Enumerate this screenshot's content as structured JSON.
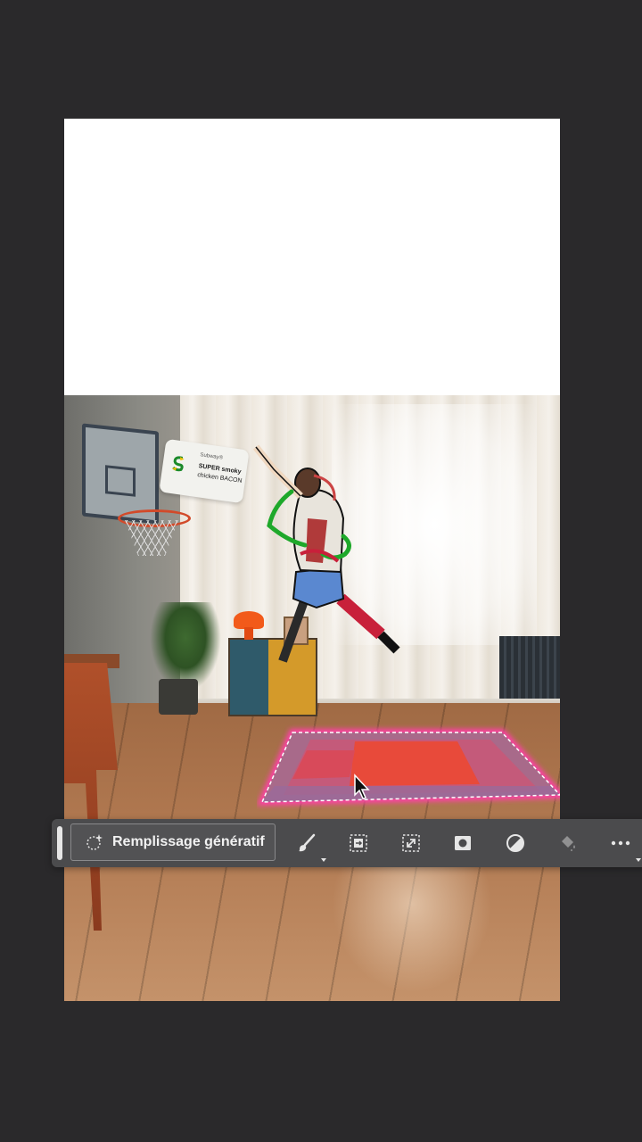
{
  "taskbar": {
    "generative_fill_label": "Remplissage génératif",
    "tools": [
      {
        "icon": "brush-icon",
        "has_menu": true
      },
      {
        "icon": "invert-selection-icon",
        "has_menu": false
      },
      {
        "icon": "transform-selection-icon",
        "has_menu": false
      },
      {
        "icon": "mask-icon",
        "has_menu": false
      },
      {
        "icon": "adjustment-icon",
        "has_menu": false
      },
      {
        "icon": "fill-bucket-icon",
        "has_menu": false,
        "disabled": true
      },
      {
        "icon": "more-icon",
        "has_menu": true
      }
    ]
  },
  "canvas": {
    "sign": {
      "brand": "Subway®",
      "line1": "SUPER smoky",
      "line2": "chicken BACON"
    }
  },
  "colors": {
    "app_background": "#2a292b",
    "taskbar_background": "#4b4b4d",
    "selection_highlight": "#ff3fa8"
  }
}
